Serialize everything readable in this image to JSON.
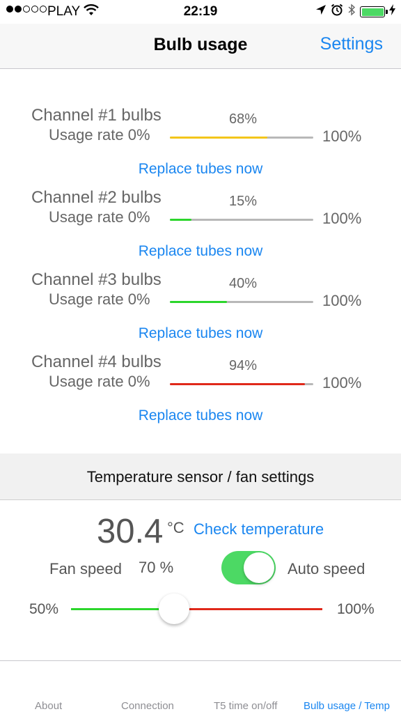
{
  "status_bar": {
    "signal_icon": "signal-dots",
    "carrier": "PLAY",
    "wifi_icon": "wifi-icon",
    "time": "22:19",
    "location_icon": "location-arrow-icon",
    "alarm_icon": "alarm-icon",
    "bluetooth_icon": "bluetooth-icon",
    "battery_level": 1.0,
    "battery_color": "#4cd964"
  },
  "nav": {
    "title": "Bulb usage",
    "settings_label": "Settings"
  },
  "channels": [
    {
      "title": "Channel #1 bulbs",
      "usage_label": "Usage rate 0%",
      "percent_text": "68%",
      "percent": 68,
      "max_label": "100%",
      "bar_color": "#f3c61a",
      "replace_label": "Replace tubes now"
    },
    {
      "title": "Channel #2 bulbs",
      "usage_label": "Usage rate 0%",
      "percent_text": "15%",
      "percent": 15,
      "max_label": "100%",
      "bar_color": "#2cd62c",
      "replace_label": "Replace tubes now"
    },
    {
      "title": "Channel #3 bulbs",
      "usage_label": "Usage rate 0%",
      "percent_text": "40%",
      "percent": 40,
      "max_label": "100%",
      "bar_color": "#2cd62c",
      "replace_label": "Replace tubes now"
    },
    {
      "title": "Channel #4 bulbs",
      "usage_label": "Usage rate 0%",
      "percent_text": "94%",
      "percent": 94,
      "max_label": "100%",
      "bar_color": "#e0281a",
      "replace_label": "Replace tubes now"
    }
  ],
  "temperature": {
    "section_title": "Temperature sensor / fan settings",
    "value": "30.4",
    "unit": "°C",
    "check_label": "Check temperature",
    "fan_speed_label": "Fan speed",
    "fan_speed_value": "70 %",
    "auto_speed_label": "Auto speed",
    "auto_speed_on": true,
    "slider_min_label": "50%",
    "slider_max_label": "100%",
    "slider_fraction": 0.41,
    "slider_low_color": "#2cd62c",
    "slider_high_color": "#e0281a"
  },
  "tabs": [
    {
      "label": "About",
      "active": false
    },
    {
      "label": "Connection",
      "active": false
    },
    {
      "label": "T5 time on/off",
      "active": false
    },
    {
      "label": "Bulb usage / Temp",
      "active": true
    }
  ],
  "colors": {
    "accent": "#1a86f0",
    "toggle_on": "#4cd964"
  }
}
